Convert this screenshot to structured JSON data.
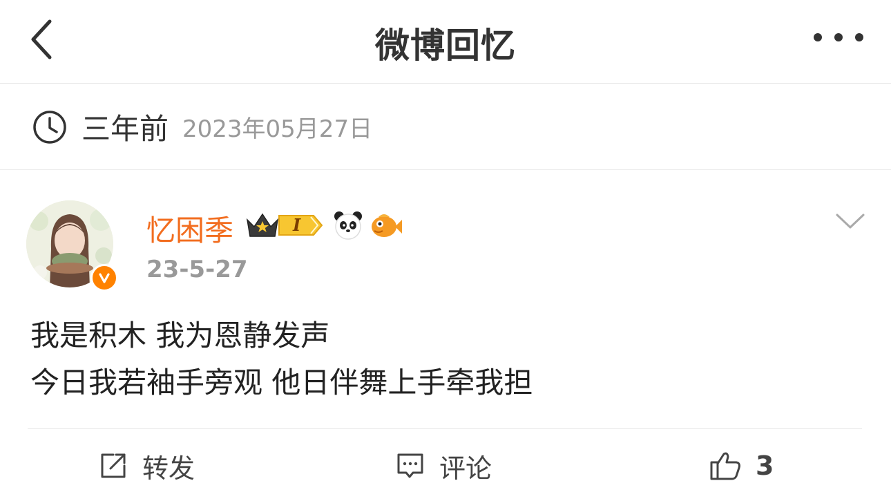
{
  "header": {
    "title": "微博回忆"
  },
  "memory": {
    "ago": "三年前",
    "date": "2023年05月27日"
  },
  "post": {
    "username": "忆困季",
    "vip_level": "I",
    "time": "23-5-27",
    "content_lines": [
      "我是积木 我为恩静发声",
      "今日我若袖手旁观 他日伴舞上手牵我担"
    ]
  },
  "actions": {
    "repost_label": "转发",
    "comment_label": "评论",
    "like_count": "3"
  },
  "colors": {
    "username": "#f26d1f",
    "verified_badge": "#ff8200",
    "vip_gold": "#f7c631"
  },
  "icons": [
    "back-chevron-icon",
    "more-dots-icon",
    "clock-icon",
    "verified-v-icon",
    "crown-icon",
    "panda-icon",
    "fish-icon",
    "chevron-down-icon",
    "repost-icon",
    "comment-icon",
    "like-thumb-icon"
  ]
}
